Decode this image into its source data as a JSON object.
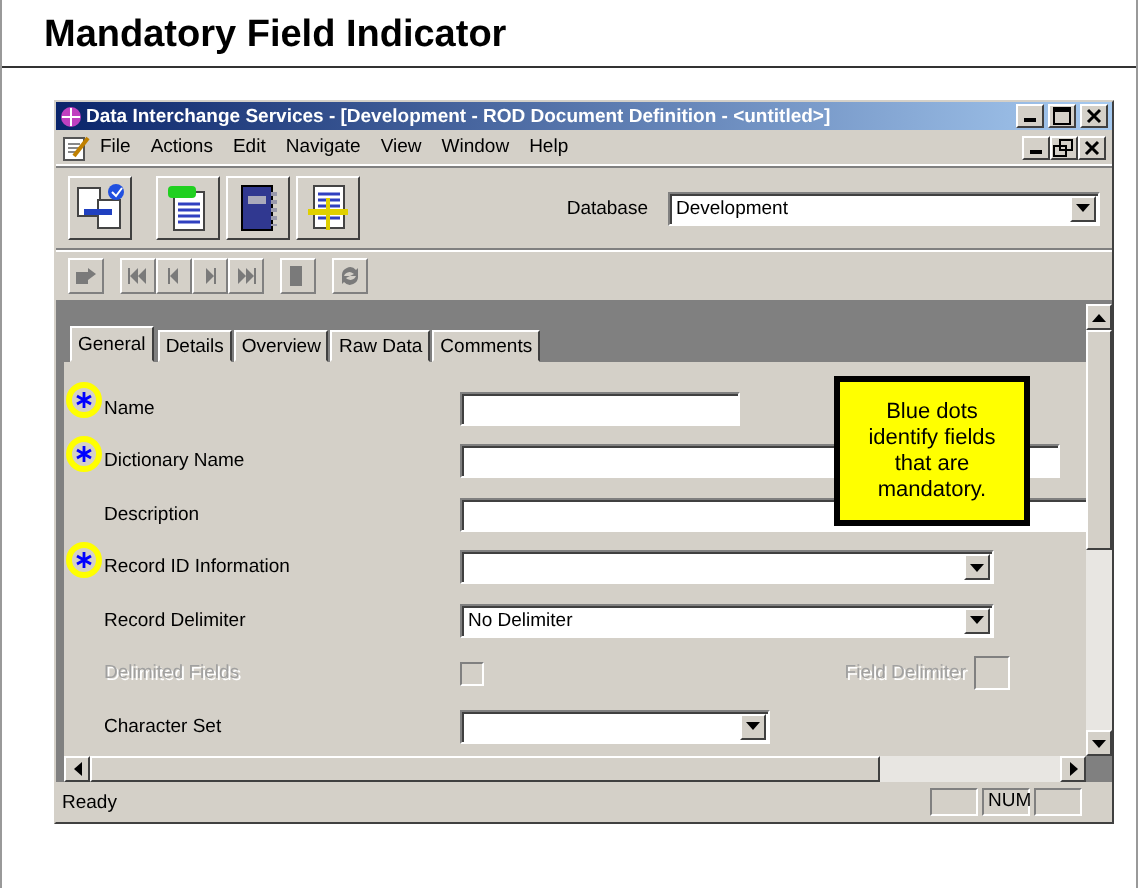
{
  "slide": {
    "title": "Mandatory Field Indicator"
  },
  "window": {
    "title": "Data Interchange Services - [Development - ROD Document Definition - <untitled>]"
  },
  "menu": [
    "File",
    "Actions",
    "Edit",
    "Navigate",
    "View",
    "Window",
    "Help"
  ],
  "toolbar": {
    "database_label": "Database",
    "database_value": "Development"
  },
  "tabs": [
    {
      "label": "General",
      "selected": true
    },
    {
      "label": "Details",
      "selected": false
    },
    {
      "label": "Overview",
      "selected": false
    },
    {
      "label": "Raw Data",
      "selected": false
    },
    {
      "label": "Comments",
      "selected": false
    }
  ],
  "fields": [
    {
      "kind": "text",
      "label": "Name",
      "required": true,
      "disabled": false
    },
    {
      "kind": "text",
      "label": "Dictionary Name",
      "required": true,
      "disabled": false
    },
    {
      "kind": "text",
      "label": "Description",
      "required": false,
      "disabled": false
    },
    {
      "kind": "dropdown",
      "label": "Record ID Information",
      "required": true,
      "disabled": false
    },
    {
      "kind": "dropdown",
      "label": "Record Delimiter",
      "value": "No Delimiter",
      "required": false,
      "disabled": false
    },
    {
      "kind": "checkbox",
      "label": "Delimited Fields",
      "checked": false,
      "extra_label": "Field Delimiter",
      "required": false,
      "disabled": true
    },
    {
      "kind": "dropdown",
      "label": "Character Set",
      "required": false,
      "disabled": false
    }
  ],
  "callout": {
    "text": "Blue dots identify fields that are mandatory."
  },
  "status_bar": {
    "text": "Ready",
    "indicators": [
      "NUM"
    ]
  }
}
